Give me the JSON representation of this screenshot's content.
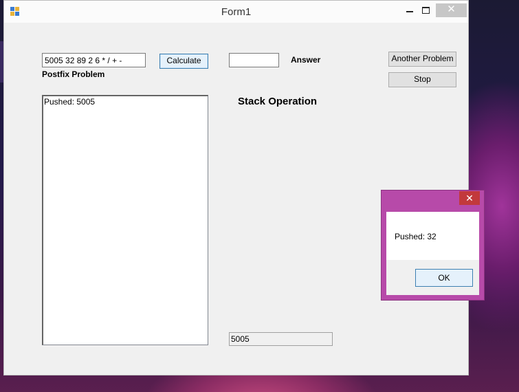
{
  "window": {
    "title": "Form1",
    "close_glyph": "✕"
  },
  "form": {
    "postfix_input_value": "5005 32 89 2 6 * / + -",
    "postfix_label": "Postfix Problem",
    "calculate_label": "Calculate",
    "answer_value": "",
    "answer_label": "Answer",
    "another_problem_label": "Another Problem",
    "stop_label": "Stop",
    "stack_heading": "Stack Operation",
    "stack_log": [
      "Pushed: 5005"
    ],
    "current_value": "5005"
  },
  "dialog": {
    "message": "Pushed: 32",
    "ok_label": "OK",
    "close_glyph": "✕"
  },
  "icons": {
    "app": "app-form-icon",
    "minimize": "minimize-icon",
    "maximize": "maximize-icon",
    "close": "close-icon"
  },
  "colors": {
    "dialog_frame": "#b74aa9",
    "close_red": "#c2393c",
    "default_button_border": "#3c7fb1"
  }
}
